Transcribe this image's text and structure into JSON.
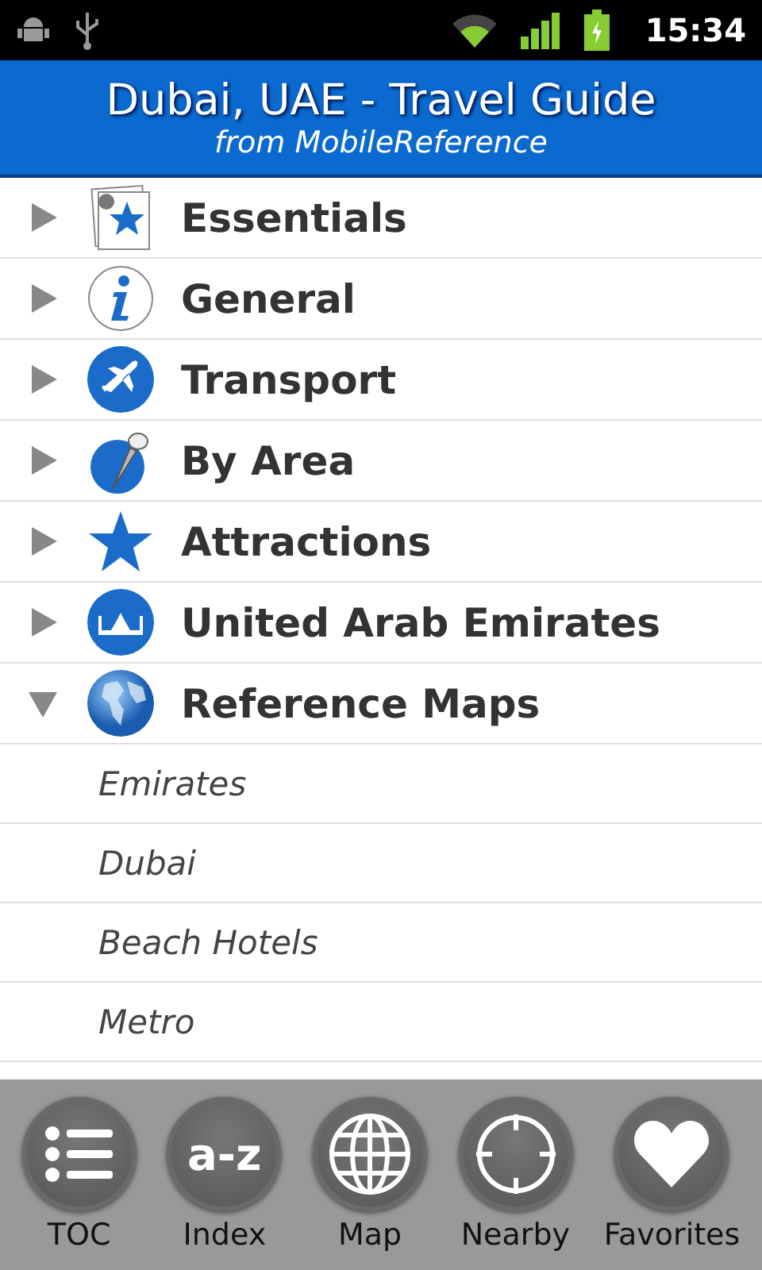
{
  "status_bar": {
    "time": "15:34"
  },
  "header": {
    "title": "Dubai, UAE - Travel Guide",
    "subtitle": "from MobileReference"
  },
  "items": [
    {
      "label": "Essentials",
      "kind": "essentials",
      "expanded": false
    },
    {
      "label": "General",
      "kind": "info",
      "expanded": false
    },
    {
      "label": "Transport",
      "kind": "plane",
      "expanded": false
    },
    {
      "label": "By Area",
      "kind": "pin",
      "expanded": false
    },
    {
      "label": "Attractions",
      "kind": "star",
      "expanded": false
    },
    {
      "label": "United Arab Emirates",
      "kind": "monument",
      "expanded": false
    },
    {
      "label": "Reference Maps",
      "kind": "globe",
      "expanded": true,
      "children": [
        {
          "label": "Emirates"
        },
        {
          "label": "Dubai"
        },
        {
          "label": "Beach Hotels"
        },
        {
          "label": "Metro"
        }
      ]
    }
  ],
  "toolbar": [
    {
      "label": "TOC",
      "kind": "toc"
    },
    {
      "label": "Index",
      "kind": "index",
      "icon_text": "a-z"
    },
    {
      "label": "Map",
      "kind": "map"
    },
    {
      "label": "Nearby",
      "kind": "nearby"
    },
    {
      "label": "Favorites",
      "kind": "favorites"
    }
  ]
}
